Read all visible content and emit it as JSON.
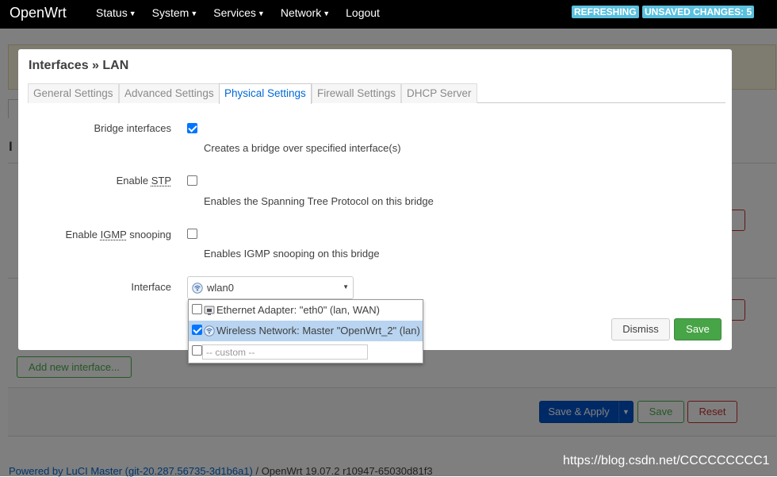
{
  "navbar": {
    "brand": "OpenWrt",
    "items": [
      {
        "label": "Status",
        "dropdown": true
      },
      {
        "label": "System",
        "dropdown": true
      },
      {
        "label": "Services",
        "dropdown": true
      },
      {
        "label": "Network",
        "dropdown": true
      },
      {
        "label": "Logout",
        "dropdown": false
      }
    ],
    "badges": {
      "refreshing": "REFRESHING",
      "unsaved": "UNSAVED CHANGES: 5"
    },
    "badge_color": "#5bc0de"
  },
  "background": {
    "add_interface": "Add new interface...",
    "save_apply": "Save & Apply",
    "save": "Save",
    "reset": "Reset",
    "footer_link": "Powered by LuCI Master (git-20.287.56735-3d1b6a1)",
    "footer_text": " / OpenWrt 19.07.2 r10947-65030d81f3"
  },
  "modal": {
    "title": "Interfaces » LAN",
    "tabs": [
      {
        "label": "General Settings",
        "active": false
      },
      {
        "label": "Advanced Settings",
        "active": false
      },
      {
        "label": "Physical Settings",
        "active": true
      },
      {
        "label": "Firewall Settings",
        "active": false
      },
      {
        "label": "DHCP Server",
        "active": false
      }
    ],
    "bridge": {
      "label": "Bridge interfaces",
      "checked": true,
      "desc": "Creates a bridge over specified interface(s)"
    },
    "stp": {
      "label_prefix": "Enable ",
      "label_abbr": "STP",
      "checked": false,
      "desc": "Enables the Spanning Tree Protocol on this bridge"
    },
    "igmp": {
      "label_prefix": "Enable ",
      "label_abbr": "IGMP",
      "label_suffix": " snooping",
      "checked": false,
      "desc": "Enables IGMP snooping on this bridge"
    },
    "interface": {
      "label": "Interface",
      "value": "wlan0",
      "value_icon": "wifi-icon",
      "options": [
        {
          "label": "Ethernet Adapter: \"eth0\" (lan, WAN)",
          "icon": "ethernet-icon",
          "checked": false
        },
        {
          "label": "Wireless Network: Master \"OpenWrt_2\" (lan)",
          "icon": "wifi-icon",
          "checked": true
        }
      ],
      "custom_placeholder": "-- custom --"
    },
    "dismiss": "Dismiss",
    "save": "Save"
  },
  "watermark": "https://blog.csdn.net/CCCCCCCCC1",
  "colors": {
    "accent": "#0069d6",
    "save_green": "#47a447",
    "checkbox_blue": "#0075ff"
  }
}
